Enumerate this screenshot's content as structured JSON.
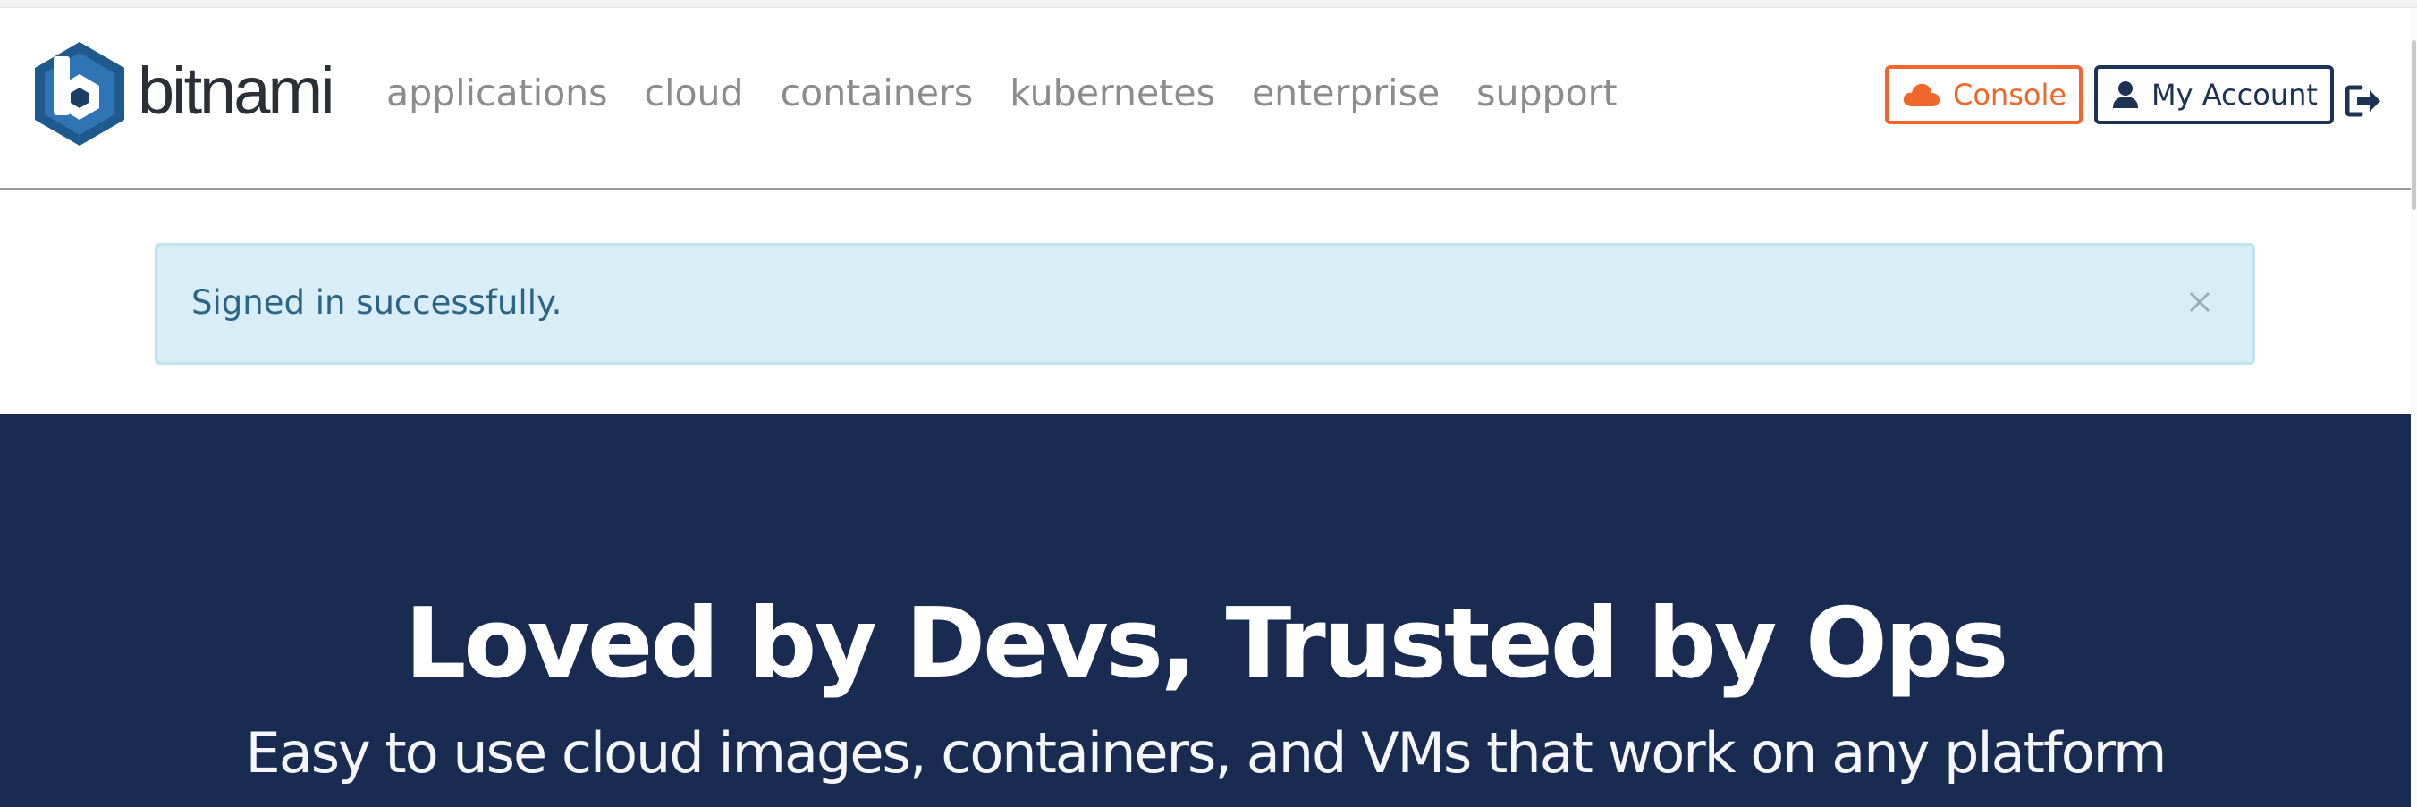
{
  "brand": {
    "name": "bitnami",
    "logo_icon": "bitnami-hexagon-logo"
  },
  "nav": {
    "links": [
      "applications",
      "cloud",
      "containers",
      "kubernetes",
      "enterprise",
      "support"
    ]
  },
  "account_bar": {
    "console_label": "Console",
    "console_icon": "cloud-icon",
    "account_label": "My Account",
    "account_icon": "user-icon",
    "signout_icon": "sign-out-icon"
  },
  "alert": {
    "message": "Signed in successfully.",
    "close_symbol": "×"
  },
  "hero": {
    "title": "Loved by Devs, Trusted by Ops",
    "subtitle": "Easy to use cloud images, containers, and VMs that work on any platform"
  },
  "colors": {
    "brand_navy": "#1a2b52",
    "console_orange": "#f0672c",
    "account_navy": "#1c3355",
    "alert_background": "#d9edf6",
    "alert_text": "#2a6585",
    "nav_text": "#8c8c8c"
  }
}
